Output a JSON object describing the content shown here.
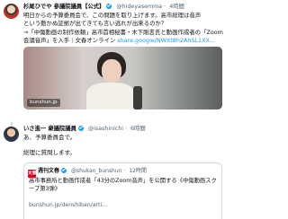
{
  "tweet1": {
    "author_name": "杉尾ひでや 参議院議員【公式】",
    "handle": "@hideyasemma",
    "separator": "·",
    "time": "4時間",
    "body_line1": "明日からの予算委員会で、この問題を取り上げます。高市総理は音声",
    "body_line2": "という動かぬ証拠が出てきても言い逃れが出来るのか？",
    "body_line3": "→「中傷動画の制作依頼」高市首相秘書・木下剛志氏と動画作成者の「Zoom",
    "body_line4_prefix": "会議音声」を入手｜文春オンライン ",
    "body_link": "share.google/NWXt8h2AhSL1XX...",
    "preview_domain": "bunshun.jp"
  },
  "tweet2": {
    "author_name": "いさ進一 衆議院議員",
    "handle": "@isashinichi",
    "separator": "·",
    "time": "6時間",
    "text1": "あ、予算委員会で。",
    "text2": "総理に質問します。"
  },
  "quote": {
    "avatar_text": "文春",
    "author_name": "週刊文春",
    "handle": "@shukan_bunshun",
    "separator": "·",
    "time": "12時間",
    "text": "高市事務所と動画作成者「43分のZoom音声」を公開する《中傷動画スクープ第3弾》",
    "link": "bunshun.jp/denshiban/arti..."
  }
}
